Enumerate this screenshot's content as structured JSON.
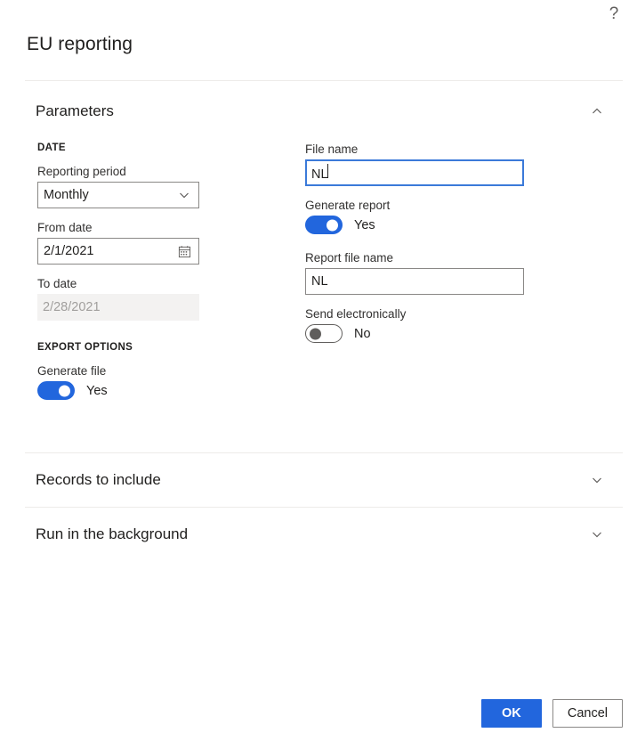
{
  "header": {
    "title": "EU reporting",
    "help_icon": "question-mark-icon"
  },
  "sections": [
    {
      "key": "parameters",
      "title": "Parameters",
      "expanded": true,
      "chevron": "chevron-up-icon"
    },
    {
      "key": "records",
      "title": "Records to include",
      "expanded": false,
      "chevron": "chevron-down-icon"
    },
    {
      "key": "background",
      "title": "Run in the background",
      "expanded": false,
      "chevron": "chevron-down-icon"
    }
  ],
  "parameters": {
    "left": {
      "date_group_label": "DATE",
      "reporting_period": {
        "label": "Reporting period",
        "value": "Monthly",
        "icon": "chevron-down-icon"
      },
      "from_date": {
        "label": "From date",
        "value": "2/1/2021",
        "icon": "calendar-icon"
      },
      "to_date": {
        "label": "To date",
        "value": "2/28/2021",
        "disabled": true
      },
      "export_group_label": "EXPORT OPTIONS",
      "generate_file": {
        "label": "Generate file",
        "state": "Yes",
        "on": true
      }
    },
    "right": {
      "file_name": {
        "label": "File name",
        "value": "NL",
        "focused": true
      },
      "generate_report": {
        "label": "Generate report",
        "state": "Yes",
        "on": true
      },
      "report_file_name": {
        "label": "Report file name",
        "value": "NL",
        "focused": false
      },
      "send_electronically": {
        "label": "Send electronically",
        "state": "No",
        "on": false
      }
    }
  },
  "footer": {
    "ok_label": "OK",
    "cancel_label": "Cancel"
  },
  "colors": {
    "accent": "#2266dd",
    "focus_border": "#3b7ad9",
    "border": "#8a8886",
    "disabled_bg": "#f3f2f1",
    "divider": "#edebe9",
    "text": "#201f1e"
  }
}
